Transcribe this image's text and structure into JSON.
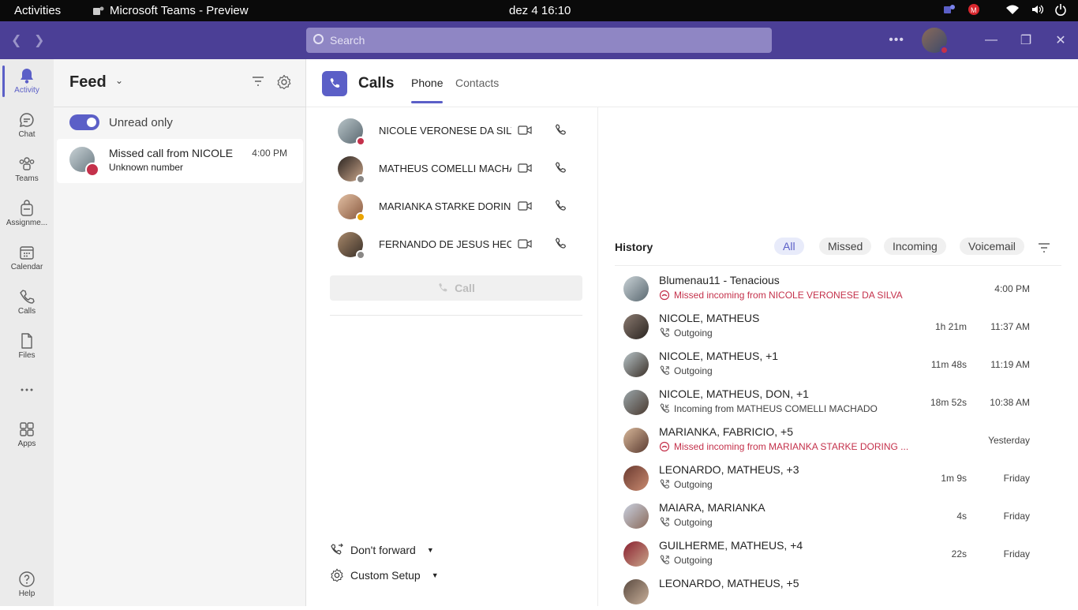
{
  "system_bar": {
    "activities": "Activities",
    "app_title": "Microsoft Teams - Preview",
    "clock": "dez 4  16:10"
  },
  "titlebar": {
    "search_placeholder": "Search"
  },
  "rail": {
    "items": [
      {
        "label": "Activity",
        "icon": "bell-icon"
      },
      {
        "label": "Chat",
        "icon": "chat-icon"
      },
      {
        "label": "Teams",
        "icon": "teams-icon"
      },
      {
        "label": "Assignme...",
        "icon": "assignments-icon"
      },
      {
        "label": "Calendar",
        "icon": "calendar-icon"
      },
      {
        "label": "Calls",
        "icon": "phone-icon"
      },
      {
        "label": "Files",
        "icon": "file-icon"
      },
      {
        "label": "",
        "icon": "more-icon"
      },
      {
        "label": "Apps",
        "icon": "apps-icon"
      },
      {
        "label": "Help",
        "icon": "help-icon"
      }
    ]
  },
  "feed": {
    "title": "Feed",
    "toggle_label": "Unread only",
    "toggle_on": true,
    "notification": {
      "title": "Missed call from NICOLE",
      "subtitle": "Unknown number",
      "time": "4:00 PM"
    }
  },
  "calls": {
    "title": "Calls",
    "tabs": [
      "Phone",
      "Contacts"
    ],
    "active_tab": "Phone",
    "speed_dial": [
      {
        "name": "NICOLE VERONESE DA SILVA",
        "status": "busy",
        "status_color": "#c4314b"
      },
      {
        "name": "MATHEUS COMELLI MACHADO",
        "status": "offline",
        "status_color": "#8a8886"
      },
      {
        "name": "MARIANKA STARKE DORING",
        "status": "away",
        "status_color": "#eaa300"
      },
      {
        "name": "FERNANDO DE JESUS HECKING",
        "status": "offline",
        "status_color": "#8a8886"
      }
    ],
    "call_button": "Call",
    "forward_label": "Don't forward",
    "setup_label": "Custom Setup"
  },
  "history": {
    "title": "History",
    "filters": [
      "All",
      "Missed",
      "Incoming",
      "Voicemail"
    ],
    "active_filter": "All",
    "rows": [
      {
        "name": "Blumenau11 - Tenacious",
        "detail": "Missed incoming from NICOLE VERONESE DA SILVA",
        "type": "missed",
        "duration": "",
        "time": "4:00 PM"
      },
      {
        "name": "NICOLE, MATHEUS",
        "detail": "Outgoing",
        "type": "outgoing",
        "duration": "1h 21m",
        "time": "11:37 AM"
      },
      {
        "name": "NICOLE, MATHEUS, +1",
        "detail": "Outgoing",
        "type": "outgoing",
        "duration": "11m 48s",
        "time": "11:19 AM"
      },
      {
        "name": "NICOLE, MATHEUS, DON, +1",
        "detail": "Incoming from MATHEUS COMELLI MACHADO",
        "type": "incoming",
        "duration": "18m 52s",
        "time": "10:38 AM"
      },
      {
        "name": "MARIANKA, FABRICIO, +5",
        "detail": "Missed incoming from MARIANKA STARKE DORING ...",
        "type": "missed",
        "duration": "",
        "time": "Yesterday"
      },
      {
        "name": "LEONARDO, MATHEUS, +3",
        "detail": "Outgoing",
        "type": "outgoing",
        "duration": "1m 9s",
        "time": "Friday"
      },
      {
        "name": "MAIARA, MARIANKA",
        "detail": "Outgoing",
        "type": "outgoing",
        "duration": "4s",
        "time": "Friday"
      },
      {
        "name": "GUILHERME, MATHEUS, +4",
        "detail": "Outgoing",
        "type": "outgoing",
        "duration": "22s",
        "time": "Friday"
      },
      {
        "name": "LEONARDO, MATHEUS, +5",
        "detail": "",
        "type": "outgoing",
        "duration": "",
        "time": ""
      }
    ]
  },
  "colors": {
    "brand": "#5b5fc7",
    "titlebar": "#4b3f96",
    "missed": "#c4314b"
  }
}
